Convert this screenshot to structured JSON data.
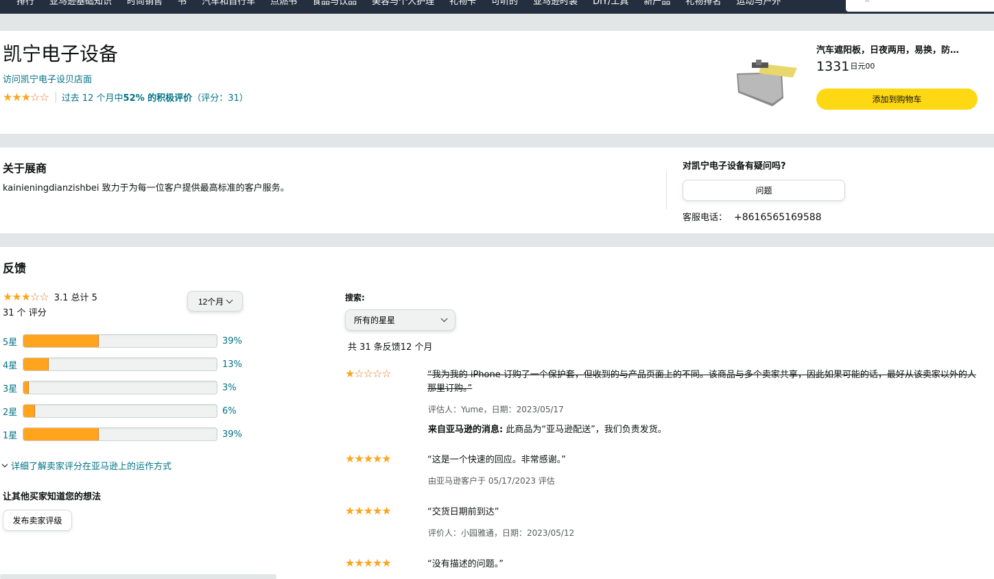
{
  "nav": {
    "items": [
      "排行",
      "亚马逊基础知识",
      "时尚销售",
      "书",
      "汽车和自行车",
      "点燃书",
      "食品与饮品",
      "美容与个人护理",
      "礼物卡",
      "可听的",
      "亚马逊时装",
      "DIY/工具",
      "新产品",
      "礼物排名",
      "运动与户外"
    ]
  },
  "seller": {
    "name": "凯宁电子设备",
    "store_link": "访问凯宁电子设贝店面",
    "rating_summary_pre": "过去 12 个月中",
    "rating_summary_bold": "52% 的积极评价",
    "rating_summary_post": "（评分：31）"
  },
  "product": {
    "title": "汽车遮阳板，日夜两用，易换，防…",
    "price_whole": "1331",
    "price_fraction": "日元00",
    "add_to_cart": "添加到购物车"
  },
  "about": {
    "title": "关于展商",
    "text": "kainieningdianzishbei 致力于为每一位客户提供最高标准的客户服务。",
    "question_title": "对凯宁电子设备有疑问吗?",
    "question_button": "问题",
    "phone_label": "客服电话：",
    "phone_number": "+8616565169588"
  },
  "feedback": {
    "title": "反馈",
    "average": "3.1 总计 5",
    "rating_count": "31 个 评分",
    "period": "12个月",
    "histogram": [
      {
        "label": "5星",
        "percent": 39,
        "text": "39%"
      },
      {
        "label": "4星",
        "percent": 13,
        "text": "13%"
      },
      {
        "label": "3星",
        "percent": 3,
        "text": "3%"
      },
      {
        "label": "2星",
        "percent": 6,
        "text": "6%"
      },
      {
        "label": "1星",
        "percent": 39,
        "text": "39%"
      }
    ],
    "learn_more": "详细了解卖家评分在亚马逊上的运作方式",
    "let_others": "让其他买家知道您的想法",
    "post_button": "发布卖家评级",
    "search_label": "搜索:",
    "star_filter": "所有的星星",
    "total_line": "共 31 条反馈12 个月"
  },
  "reviews": [
    {
      "stars": 1,
      "text": "“我为我的 iPhone 订购了一个保护套，但收到的与产品页面上的不同。该商品与多个卖家共享，因此如果可能的话，最好从该卖家以外的人那里订购。”",
      "meta": "评估人：Yume，日期：2023/05/17",
      "amazon_label": "来自亚马逊的消息:",
      "amazon_text": " 此商品为“亚马逊配送”，我们负责发货。"
    },
    {
      "stars": 5,
      "text": "“这是一个快速的回应。非常感谢。”",
      "meta": "由亚马逊客户于 05/17/2023 评估"
    },
    {
      "stars": 5,
      "text": "“交货日期前到达”",
      "meta": "评价人：小园雅通，日期：2023/05/12"
    },
    {
      "stars": 5,
      "text": "“没有描述的问题。”"
    }
  ],
  "colors": {
    "star": "#ffa41c",
    "link": "#007185",
    "cart_button": "#ffd814",
    "nav_bg": "#232f3e"
  }
}
